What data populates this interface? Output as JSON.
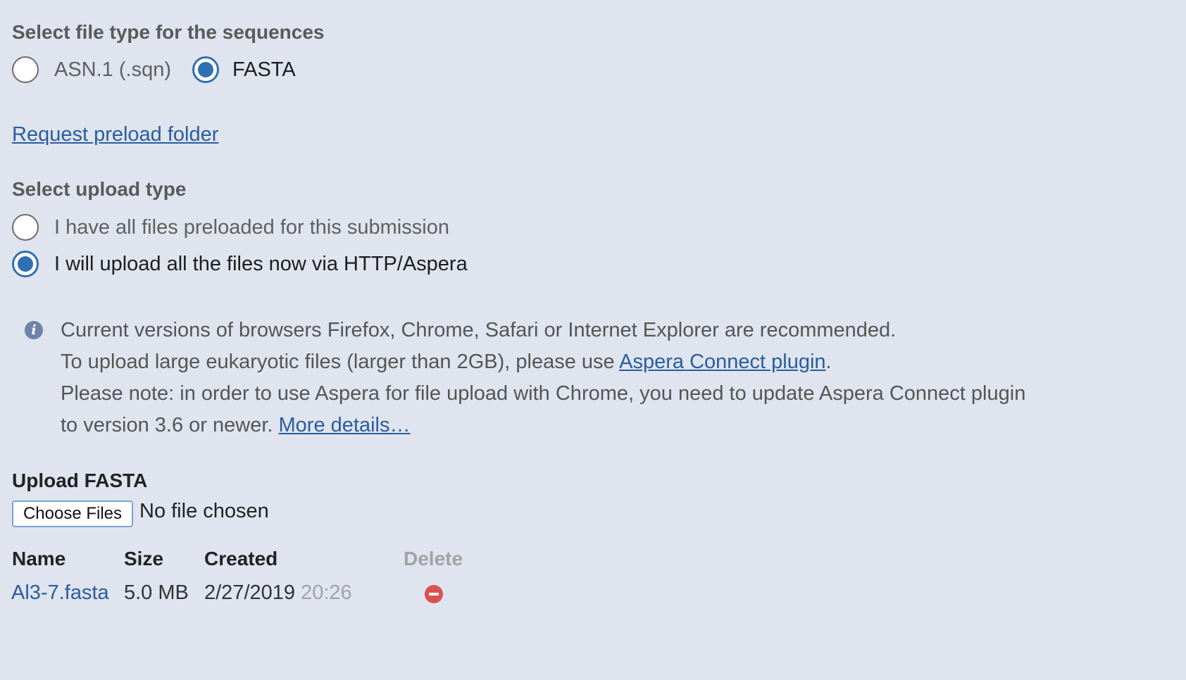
{
  "file_type": {
    "heading": "Select file type for the sequences",
    "options": [
      {
        "label": "ASN.1 (.sqn)",
        "checked": false
      },
      {
        "label": "FASTA",
        "checked": true
      }
    ]
  },
  "preload_link": "Request preload folder",
  "upload_type": {
    "heading": "Select upload type",
    "options": [
      {
        "label": "I have all files preloaded for this submission",
        "checked": false
      },
      {
        "label": "I will upload all the files now via HTTP/Aspera",
        "checked": true
      }
    ]
  },
  "info": {
    "line1": "Current versions of browsers Firefox, Chrome, Safari or Internet Explorer are recommended.",
    "line2_prefix": "To upload large eukaryotic files (larger than 2GB), please use ",
    "line2_link": "Aspera Connect plugin",
    "line2_suffix": ".",
    "line3": "Please note: in order to use Aspera for file upload with Chrome, you need to update Aspera Connect plugin",
    "line4_prefix": "to version 3.6 or newer. ",
    "line4_link": "More details…"
  },
  "upload": {
    "heading": "Upload FASTA",
    "choose_button": "Choose Files",
    "no_file": "No file chosen"
  },
  "table": {
    "headers": {
      "name": "Name",
      "size": "Size",
      "created": "Created",
      "delete": "Delete"
    },
    "rows": [
      {
        "name": "Al3-7.fasta",
        "size": "5.0 MB",
        "date": "2/27/2019",
        "time": "20:26"
      }
    ]
  },
  "colors": {
    "background": "#dfe4ee",
    "accent": "#2f6fb3",
    "link": "#2a5d9e",
    "delete": "#d9534f"
  }
}
